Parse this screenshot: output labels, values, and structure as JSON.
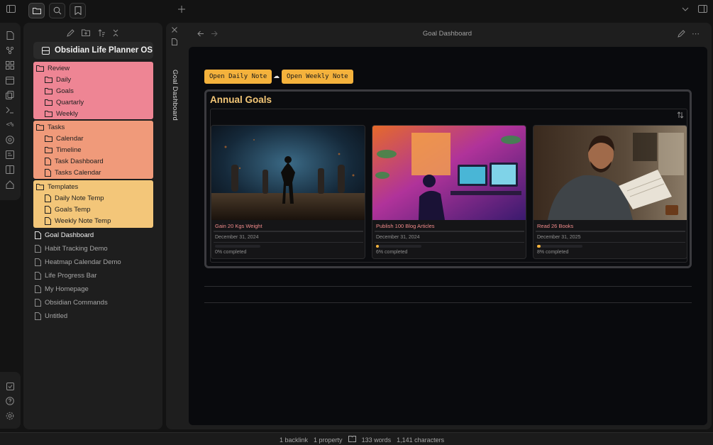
{
  "app": {
    "colors": {
      "background": "#131313",
      "panel": "#1e1e1e",
      "accent": "#f4b23c",
      "review": "#ee8594",
      "tasks": "#f09a7a",
      "templates": "#f3c679"
    }
  },
  "topbar": {
    "icons": [
      "sidebar-toggle-icon",
      "folder-icon",
      "search-icon",
      "bookmark-icon",
      "plus-icon",
      "chevron-down-icon",
      "right-sidebar-toggle-icon"
    ]
  },
  "ribbon": {
    "icons": [
      "new-note-icon",
      "graph-icon",
      "canvas-icon",
      "calendar-icon",
      "copy-icon",
      "terminal-icon",
      "template-icon",
      "help-icon",
      "slides-icon",
      "book-icon",
      "home-icon"
    ],
    "bottom_icons": [
      "vault-icon",
      "help-circle-icon",
      "settings-icon"
    ]
  },
  "sidebar": {
    "vault_name": "Obsidian Life Planner OS",
    "review": {
      "label": "Review",
      "children": [
        "Daily",
        "Goals",
        "Quartarly",
        "Weekly"
      ]
    },
    "tasks": {
      "label": "Tasks",
      "children": [
        "Calendar",
        "Timeline",
        "Task Dashboard",
        "Tasks Calendar"
      ]
    },
    "templates": {
      "label": "Templates",
      "children": [
        "Daily Note Temp",
        "Goals Temp",
        "Weekly Note Temp"
      ]
    },
    "files": [
      "Goal Dashboard",
      "Habit Tracking Demo",
      "Heatmap Calendar Demo",
      "Life Progress Bar",
      "My Homepage",
      "Obsidian Commands",
      "Untitled"
    ]
  },
  "tab": {
    "label": "Goal Dashboard"
  },
  "pane": {
    "title": "Goal Dashboard"
  },
  "dashboard": {
    "open_daily": "Open Daily Note",
    "separator": "☁",
    "open_weekly": "Open Weekly Note",
    "card_title": "Annual Goals",
    "goals": [
      {
        "name": "Gain 20 Kgs Weight",
        "date": "December 31, 2024",
        "progress": 0,
        "progress_label": "0% completed"
      },
      {
        "name": "Publish 100 Blog Articles",
        "date": "December 31, 2024",
        "progress": 6,
        "progress_label": "6% completed"
      },
      {
        "name": "Read 26 Books",
        "date": "December 31, 2025",
        "progress": 8,
        "progress_label": "8% completed"
      }
    ]
  },
  "statusbar": {
    "backlinks": "1 backlink",
    "properties": "1 property",
    "words": "133 words",
    "characters": "1,141 characters"
  }
}
